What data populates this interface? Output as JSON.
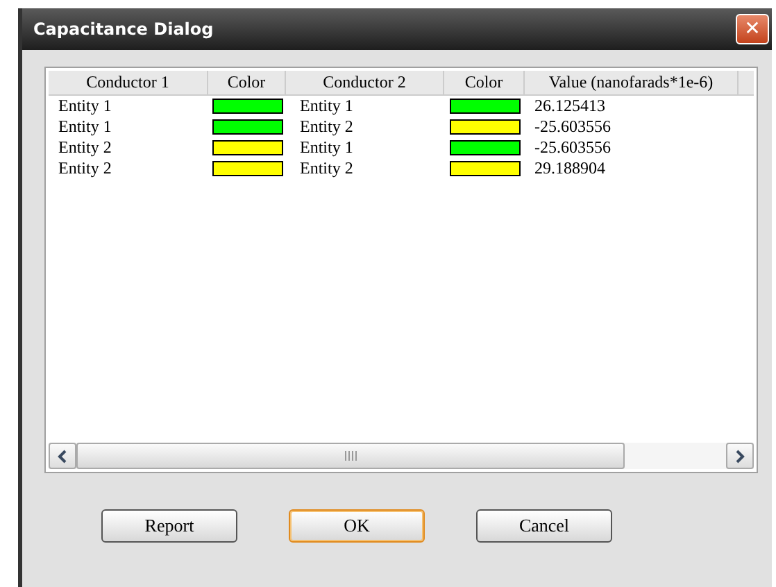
{
  "window": {
    "title": "Capacitance Dialog",
    "close_glyph": "✕"
  },
  "table": {
    "columns": [
      "Conductor 1",
      "Color",
      "Conductor 2",
      "Color",
      "Value (nanofarads*1e-6)"
    ],
    "rows": [
      {
        "cells": [
          {
            "kind": "text",
            "text": "Entity 1"
          },
          {
            "kind": "swatch",
            "color": "#00ff00"
          },
          {
            "kind": "text",
            "text": "Entity 1"
          },
          {
            "kind": "swatch",
            "color": "#00ff00"
          },
          {
            "kind": "text",
            "text": "26.125413"
          }
        ]
      },
      {
        "cells": [
          {
            "kind": "text",
            "text": "Entity 1"
          },
          {
            "kind": "swatch",
            "color": "#00ff00"
          },
          {
            "kind": "text",
            "text": "Entity 2"
          },
          {
            "kind": "swatch",
            "color": "#ffff00"
          },
          {
            "kind": "text",
            "text": "-25.603556"
          }
        ]
      },
      {
        "cells": [
          {
            "kind": "text",
            "text": "Entity 2"
          },
          {
            "kind": "swatch",
            "color": "#ffff00"
          },
          {
            "kind": "text",
            "text": "Entity 1"
          },
          {
            "kind": "swatch",
            "color": "#00ff00"
          },
          {
            "kind": "text",
            "text": "-25.603556"
          }
        ]
      },
      {
        "cells": [
          {
            "kind": "text",
            "text": "Entity 2"
          },
          {
            "kind": "swatch",
            "color": "#ffff00"
          },
          {
            "kind": "text",
            "text": "Entity 2"
          },
          {
            "kind": "swatch",
            "color": "#ffff00"
          },
          {
            "kind": "text",
            "text": "29.188904"
          }
        ]
      }
    ]
  },
  "buttons": [
    {
      "label": "Report",
      "default": false
    },
    {
      "label": "OK",
      "default": true
    },
    {
      "label": "Cancel",
      "default": false
    }
  ]
}
